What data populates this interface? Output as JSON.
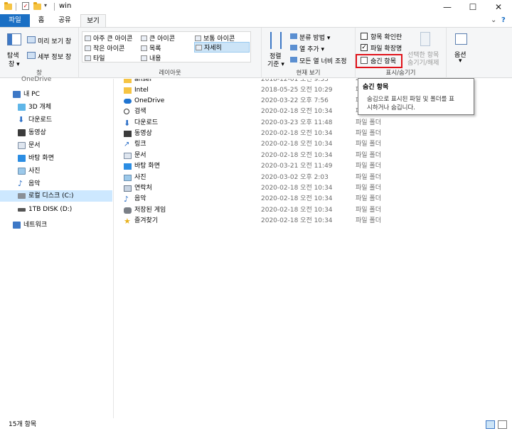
{
  "window": {
    "title": "win",
    "minimize": "—",
    "maximize": "☐",
    "close": "✕"
  },
  "tabs": {
    "file": "파일",
    "home": "홈",
    "share": "공유",
    "view": "보기"
  },
  "ribbon": {
    "pane_group": {
      "nav_pane": "탐색\n창",
      "nav_pane_line1": "탐색",
      "nav_pane_line2": "창 ▾",
      "preview_pane": "미리 보기 창",
      "details_pane": "세부 정보 창",
      "label": "창"
    },
    "layout_group": {
      "items": [
        "아주 큰 아이콘",
        "큰 아이콘",
        "보통 아이콘",
        "작은 아이콘",
        "목록",
        "자세히",
        "타일",
        "내용"
      ],
      "selected": "자세히",
      "label": "레이아웃"
    },
    "current_view_group": {
      "sort_line1": "정렬",
      "sort_line2": "기준 ▾",
      "group_by": "분류 방법 ▾",
      "add_columns": "열 추가 ▾",
      "size_all_columns": "모든 열 너비 조정",
      "label": "현재 보기"
    },
    "show_hide_group": {
      "item_checkboxes": "항목 확인란",
      "item_checkboxes_checked": false,
      "file_extensions": "파일 확장명",
      "file_extensions_checked": true,
      "hidden_items": "숨긴 항목",
      "hidden_items_checked": false,
      "hide_selected_line1": "선택한 항목",
      "hide_selected_line2": "숨기기/해제",
      "label": "표시/숨기기"
    },
    "options": {
      "label": "옵션",
      "arrow": "▾"
    }
  },
  "tooltip": {
    "title": "숨긴 항목",
    "body_line1": "숨김으로 표시된 파일 및 폴더를 표",
    "body_line2": "시하거나 숨깁니다."
  },
  "nav": {
    "top_partial": "OneDrive",
    "items": [
      {
        "label": "내 PC",
        "icon": "pc-icon"
      },
      {
        "label": "3D 개체",
        "icon": "3d-objects-icon"
      },
      {
        "label": "다운로드",
        "icon": "download-icon"
      },
      {
        "label": "동영상",
        "icon": "video-icon"
      },
      {
        "label": "문서",
        "icon": "document-icon"
      },
      {
        "label": "바탕 화면",
        "icon": "desktop-icon"
      },
      {
        "label": "사진",
        "icon": "picture-icon"
      },
      {
        "label": "음악",
        "icon": "music-icon"
      },
      {
        "label": "로컬 디스크 (C:)",
        "icon": "drive-c-icon"
      },
      {
        "label": "1TB DISK (D:)",
        "icon": "drive-d-icon"
      },
      {
        "label": "네트워크",
        "icon": "network-icon"
      }
    ]
  },
  "files": [
    {
      "name": "ansel",
      "date": "2018-12-01 오전 9:33",
      "type": "파일 폴더",
      "icon": "folder-icon"
    },
    {
      "name": "Intel",
      "date": "2018-05-25 오전 10:29",
      "type": "파일 폴더",
      "icon": "folder-icon"
    },
    {
      "name": "OneDrive",
      "date": "2020-03-22 오후 7:56",
      "type": "파일 폴더",
      "icon": "onedrive-icon"
    },
    {
      "name": "검색",
      "date": "2020-02-18 오전 10:34",
      "type": "파일 폴더",
      "icon": "search-icon"
    },
    {
      "name": "다운로드",
      "date": "2020-03-23 오후 11:48",
      "type": "파일 폴더",
      "icon": "download-icon"
    },
    {
      "name": "동영상",
      "date": "2020-02-18 오전 10:34",
      "type": "파일 폴더",
      "icon": "video-icon"
    },
    {
      "name": "링크",
      "date": "2020-02-18 오전 10:34",
      "type": "파일 폴더",
      "icon": "link-icon"
    },
    {
      "name": "문서",
      "date": "2020-02-18 오전 10:34",
      "type": "파일 폴더",
      "icon": "document-icon"
    },
    {
      "name": "바탕 화면",
      "date": "2020-03-21 오전 11:49",
      "type": "파일 폴더",
      "icon": "desktop-icon"
    },
    {
      "name": "사진",
      "date": "2020-03-02 오후 2:03",
      "type": "파일 폴더",
      "icon": "picture-icon"
    },
    {
      "name": "연락처",
      "date": "2020-02-18 오전 10:34",
      "type": "파일 폴더",
      "icon": "contacts-icon"
    },
    {
      "name": "음악",
      "date": "2020-02-18 오전 10:34",
      "type": "파일 폴더",
      "icon": "music-icon"
    },
    {
      "name": "저장된 게임",
      "date": "2020-02-18 오전 10:34",
      "type": "파일 폴더",
      "icon": "saved-games-icon"
    },
    {
      "name": "즐겨찾기",
      "date": "2020-02-18 오전 10:34",
      "type": "파일 폴더",
      "icon": "favorites-icon"
    }
  ],
  "status": {
    "item_count": "15개 항목"
  },
  "colors": {
    "file_tab": "#1a6fc4",
    "selection": "#cde8ff",
    "highlight_box": "#e0121a"
  }
}
